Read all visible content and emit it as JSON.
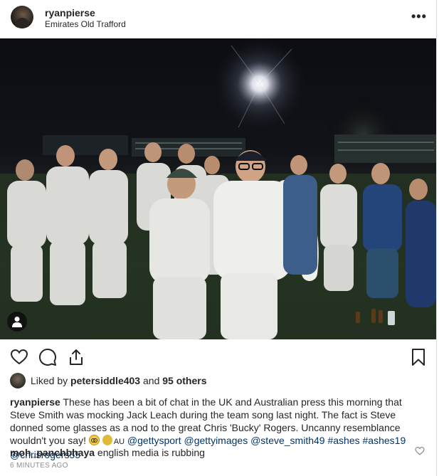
{
  "header": {
    "username": "ryanpierse",
    "location": "Emirates Old Trafford",
    "more_label": "•••"
  },
  "photo": {
    "alt": "Team celebrating on the cricket ground at night",
    "tag_icon": "user-tag-icon"
  },
  "actions": {
    "like_icon": "heart-icon",
    "comment_icon": "comment-icon",
    "share_icon": "share-icon",
    "save_icon": "bookmark-icon"
  },
  "likes": {
    "prefix": "Liked by ",
    "user": "petersiddle403",
    "middle": " and ",
    "others": "95 others"
  },
  "caption": {
    "username": "ryanpierse",
    "text": " These has been a bit of chat in the UK and Australian press this morning that Steve Smith was mocking Jack Leach during the team song last night. The fact is Steve donned some glasses as a nod to the great Chris 'Bucky' Rogers. Uncanny resemblance wouldn't you say! ",
    "flag_label": "AU",
    "mentions": [
      "@gettysport",
      "@gettyimages",
      "@steve_smith49",
      "#ashes",
      "#ashes19",
      "@chrisrogers55"
    ]
  },
  "comment": {
    "username": "moh_panchbhaya",
    "text": " english media is rubbing"
  },
  "timestamp": "6 MINUTES AGO"
}
